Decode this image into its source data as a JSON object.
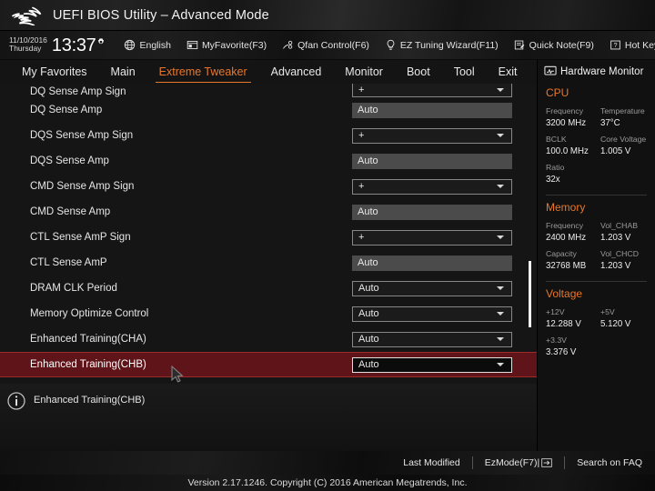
{
  "window": {
    "title": "UEFI BIOS Utility – Advanced Mode",
    "logo_icon": "rog-eye-logo"
  },
  "infobar": {
    "date": "11/10/2016",
    "weekday": "Thursday",
    "time": "13:37",
    "gear_icon": "gear-icon",
    "items": [
      {
        "label": "English",
        "icon": "globe-icon"
      },
      {
        "label": "MyFavorite(F3)",
        "icon": "window-icon"
      },
      {
        "label": "Qfan Control(F6)",
        "icon": "fan-icon"
      },
      {
        "label": "EZ Tuning Wizard(F11)",
        "icon": "bulb-icon"
      },
      {
        "label": "Quick Note(F9)",
        "icon": "note-icon"
      },
      {
        "label": "Hot Keys",
        "icon": "question-box-icon"
      }
    ]
  },
  "nav": {
    "tabs": [
      {
        "label": "My Favorites",
        "active": false
      },
      {
        "label": "Main",
        "active": false
      },
      {
        "label": "Extreme Tweaker",
        "active": true
      },
      {
        "label": "Advanced",
        "active": false
      },
      {
        "label": "Monitor",
        "active": false
      },
      {
        "label": "Boot",
        "active": false
      },
      {
        "label": "Tool",
        "active": false
      },
      {
        "label": "Exit",
        "active": false
      }
    ],
    "active_color": "#e8772a"
  },
  "settings": {
    "rows": [
      {
        "label": "DQ Sense Amp Sign",
        "value": "+",
        "type": "dropdown",
        "selected": false,
        "clipped": true
      },
      {
        "label": "DQ Sense Amp",
        "value": "Auto",
        "type": "plain",
        "selected": false,
        "clipped": false
      },
      {
        "label": "DQS Sense Amp Sign",
        "value": "+",
        "type": "dropdown",
        "selected": false,
        "clipped": false
      },
      {
        "label": "DQS Sense Amp",
        "value": "Auto",
        "type": "plain",
        "selected": false,
        "clipped": false
      },
      {
        "label": "CMD Sense Amp Sign",
        "value": "+",
        "type": "dropdown",
        "selected": false,
        "clipped": false
      },
      {
        "label": "CMD Sense Amp",
        "value": "Auto",
        "type": "plain",
        "selected": false,
        "clipped": false
      },
      {
        "label": "CTL Sense AmP Sign",
        "value": "+",
        "type": "dropdown",
        "selected": false,
        "clipped": false
      },
      {
        "label": "CTL Sense AmP",
        "value": "Auto",
        "type": "plain",
        "selected": false,
        "clipped": false
      },
      {
        "label": "DRAM CLK Period",
        "value": "Auto",
        "type": "dropdown",
        "selected": false,
        "clipped": false
      },
      {
        "label": "Memory Optimize Control",
        "value": "Auto",
        "type": "dropdown",
        "selected": false,
        "clipped": false
      },
      {
        "label": "Enhanced Training(CHA)",
        "value": "Auto",
        "type": "dropdown",
        "selected": false,
        "clipped": false
      },
      {
        "label": "Enhanced Training(CHB)",
        "value": "Auto",
        "type": "dropdown",
        "selected": true,
        "clipped": false
      }
    ],
    "selected_row_color": "#5e1418"
  },
  "help": {
    "icon": "info-icon",
    "text": "Enhanced Training(CHB)"
  },
  "hardware_monitor": {
    "title": "Hardware Monitor",
    "title_icon": "monitor-icon",
    "accent_color": "#e8772a",
    "groups": [
      {
        "name": "CPU",
        "pairs": [
          [
            {
              "key": "Frequency",
              "value": "3200 MHz"
            },
            {
              "key": "Temperature",
              "value": "37°C"
            }
          ],
          [
            {
              "key": "BCLK",
              "value": "100.0 MHz"
            },
            {
              "key": "Core Voltage",
              "value": "1.005 V"
            }
          ],
          [
            {
              "key": "Ratio",
              "value": "32x"
            },
            {
              "key": "",
              "value": ""
            }
          ]
        ]
      },
      {
        "name": "Memory",
        "pairs": [
          [
            {
              "key": "Frequency",
              "value": "2400 MHz"
            },
            {
              "key": "Vol_CHAB",
              "value": "1.203 V"
            }
          ],
          [
            {
              "key": "Capacity",
              "value": "32768 MB"
            },
            {
              "key": "Vol_CHCD",
              "value": "1.203 V"
            }
          ]
        ]
      },
      {
        "name": "Voltage",
        "pairs": [
          [
            {
              "key": "+12V",
              "value": "12.288 V"
            },
            {
              "key": "+5V",
              "value": "5.120 V"
            }
          ],
          [
            {
              "key": "+3.3V",
              "value": "3.376 V"
            },
            {
              "key": "",
              "value": ""
            }
          ]
        ]
      }
    ]
  },
  "footer": {
    "last_modified": "Last Modified",
    "ez_mode": "EzMode(F7)|",
    "ez_mode_icon": "arrow-right-box-icon",
    "search_faq": "Search on FAQ"
  },
  "version_bar": {
    "text": "Version 2.17.1246. Copyright (C) 2016 American Megatrends, Inc."
  }
}
